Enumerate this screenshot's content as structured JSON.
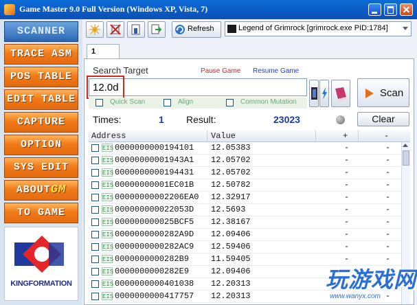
{
  "window": {
    "title": "Game Master 9.0 Full Version (Windows XP, Vista, 7)"
  },
  "menu": {
    "scanner": "SCANNER",
    "trace_asm": "TRACE ASM",
    "pos_table": "POS TABLE",
    "edit_table": "EDIT TABLE",
    "capture": "CAPTURE",
    "option": "OPTION",
    "sys_edit": "SYS EDIT",
    "about": "ABOUT",
    "about_suffix": "GM",
    "to_game": "TO GAME"
  },
  "logo": {
    "text": "KINGFORMATION"
  },
  "toolbar": {
    "refresh_label": "Refresh",
    "process": "Legend of Grimrock [grimrock.exe PID:1784]"
  },
  "tab": {
    "label": "1"
  },
  "search": {
    "label": "Search Target",
    "pause_label": "Pause Game",
    "resume_label": "Resume Game",
    "value": "12.0d",
    "options": {
      "quick_scan": "Quick Scan",
      "align": "Align",
      "common_mutation": "Common Mutation"
    },
    "scan_label": "Scan"
  },
  "stats": {
    "times_label": "Times:",
    "times_value": "1",
    "result_label": "Result:",
    "result_value": "23023",
    "clear_label": "Clear"
  },
  "table": {
    "columns": {
      "address": "Address",
      "value": "Value",
      "plus": "+",
      "minus": "-"
    },
    "badge": "EIS",
    "rows": [
      {
        "address": "0000000000194101",
        "value": "12.05383",
        "plus": "-",
        "minus": "-"
      },
      {
        "address": "00000000001943A1",
        "value": "12.05702",
        "plus": "-",
        "minus": "-"
      },
      {
        "address": "0000000000194431",
        "value": "12.05702",
        "plus": "-",
        "minus": "-"
      },
      {
        "address": "00000000001EC01B",
        "value": "12.50782",
        "plus": "-",
        "minus": "-"
      },
      {
        "address": "00000000002206EA0",
        "value": "12.32917",
        "plus": "-",
        "minus": "-"
      },
      {
        "address": "000000000022053D",
        "value": "12.5693",
        "plus": "-",
        "minus": "-"
      },
      {
        "address": "000000000025BCF5",
        "value": "12.38167",
        "plus": "-",
        "minus": "-"
      },
      {
        "address": "0000000000282A9D",
        "value": "12.09406",
        "plus": "-",
        "minus": "-"
      },
      {
        "address": "0000000000282AC9",
        "value": "12.59406",
        "plus": "-",
        "minus": "-"
      },
      {
        "address": "0000000000282B9",
        "value": "11.59405",
        "plus": "-",
        "minus": "-"
      },
      {
        "address": "0000000000282E9",
        "value": "12.09406",
        "plus": "-",
        "minus": "-"
      },
      {
        "address": "0000000000401038",
        "value": "12.20313",
        "plus": "-",
        "minus": "-"
      },
      {
        "address": "0000000000417757",
        "value": "12.20313",
        "plus": "-",
        "minus": "-"
      }
    ]
  },
  "watermark": {
    "text": "玩游戏网",
    "url": "www.wanyx.com"
  }
}
